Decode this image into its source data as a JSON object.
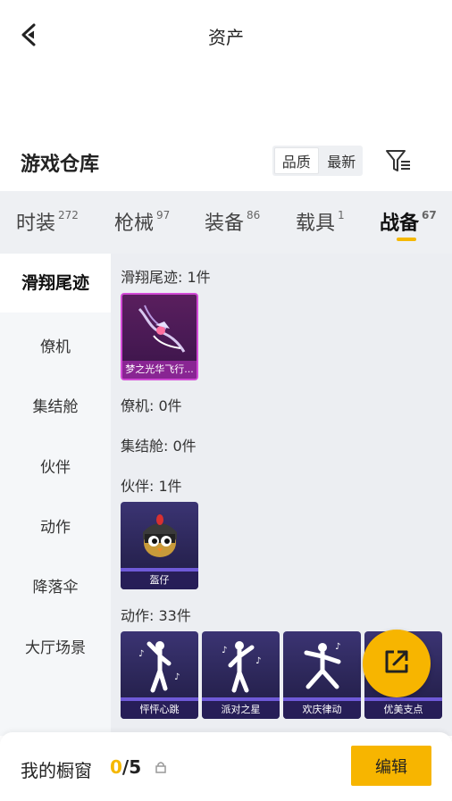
{
  "header": {
    "title": "资产",
    "back_icon": "chevron-left-icon"
  },
  "repo": {
    "title": "游戏仓库"
  },
  "sort": {
    "options": [
      "品质",
      "最新"
    ],
    "active": "品质"
  },
  "tabs": [
    {
      "label": "时装",
      "count": "272"
    },
    {
      "label": "枪械",
      "count": "97"
    },
    {
      "label": "装备",
      "count": "86"
    },
    {
      "label": "载具",
      "count": "1"
    },
    {
      "label": "战备",
      "count": "67"
    }
  ],
  "active_tab": "战备",
  "sidebar": {
    "items": [
      {
        "label": "滑翔尾迹"
      },
      {
        "label": "僚机"
      },
      {
        "label": "集结舱"
      },
      {
        "label": "伙伴"
      },
      {
        "label": "动作"
      },
      {
        "label": "降落伞"
      },
      {
        "label": "大厅场景"
      }
    ],
    "active": "滑翔尾迹"
  },
  "sections": [
    {
      "label": "滑翔尾迹: 1件",
      "items": [
        {
          "name": "梦之光华飞行..."
        }
      ]
    },
    {
      "label": "僚机: 0件",
      "items": []
    },
    {
      "label": "集结舱: 0件",
      "items": []
    },
    {
      "label": "伙伴: 1件",
      "items": [
        {
          "name": "盔仔"
        }
      ]
    },
    {
      "label": "动作: 33件",
      "items": [
        {
          "name": "怦怦心跳"
        },
        {
          "name": "派对之星"
        },
        {
          "name": "欢庆律动"
        },
        {
          "name": "优美支点"
        }
      ]
    }
  ],
  "showcase": {
    "label": "我的橱窗",
    "current": "0",
    "total": "/5"
  },
  "edit_button": {
    "label": "编辑"
  },
  "colors": {
    "accent": "#f7b500",
    "tab_bg": "#eef0f3",
    "content_bg": "#eceef2"
  }
}
